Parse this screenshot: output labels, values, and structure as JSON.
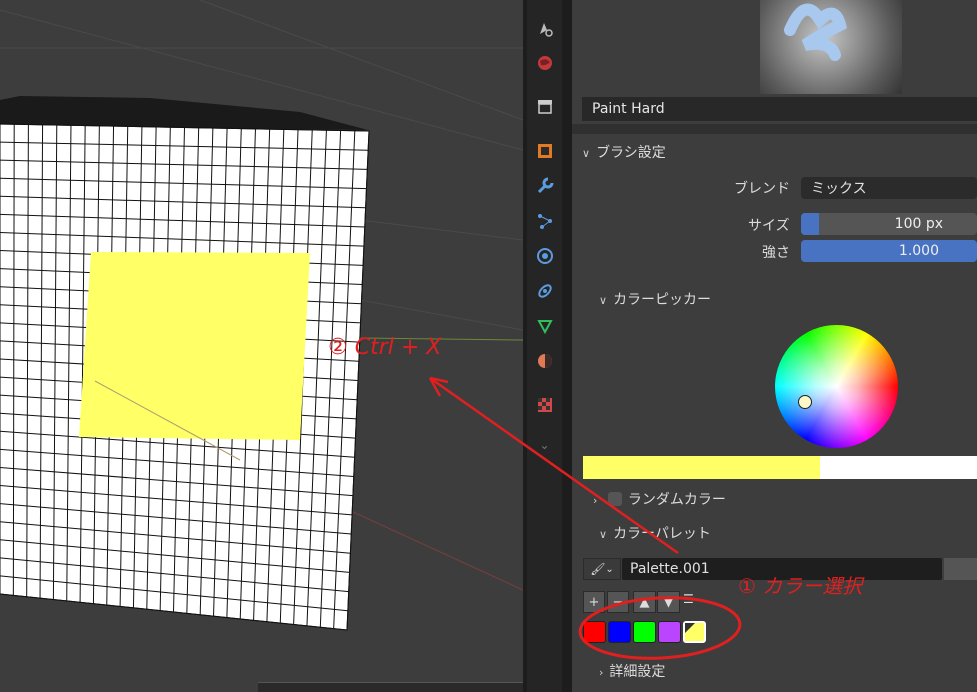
{
  "brush": {
    "preview_name": "Paint Hard"
  },
  "brush_settings": {
    "header": "ブラシ設定",
    "blend_label": "ブレンド",
    "blend_value": "ミックス",
    "size_label": "サイズ",
    "size_value": "100 px",
    "size_fraction": 0.1,
    "strength_label": "強さ",
    "strength_value": "1.000",
    "strength_fraction": 1.0
  },
  "color_picker": {
    "header": "カラーピッカー",
    "current_color": "#ffff66",
    "secondary_color": "#ffffff"
  },
  "random_color": {
    "label": "ランダムカラー"
  },
  "color_palette": {
    "header": "カラーパレット",
    "palette_name": "Palette.001",
    "swatches": [
      "#ff0000",
      "#0000ff",
      "#00ff00",
      "#bb44ff",
      "#ffff66"
    ]
  },
  "advanced": {
    "header": "詳細設定"
  },
  "annotations": {
    "step1_text": "① カラー選択",
    "step2_text": "② Ctrl + X",
    "color": "#e02020"
  },
  "tabs": [
    "tool-icon",
    "world-icon",
    "collection-icon",
    "object-icon",
    "wrench-icon",
    "particles-icon",
    "physics-icon",
    "constraints-icon",
    "data-icon",
    "material-icon",
    "texture-icon"
  ]
}
